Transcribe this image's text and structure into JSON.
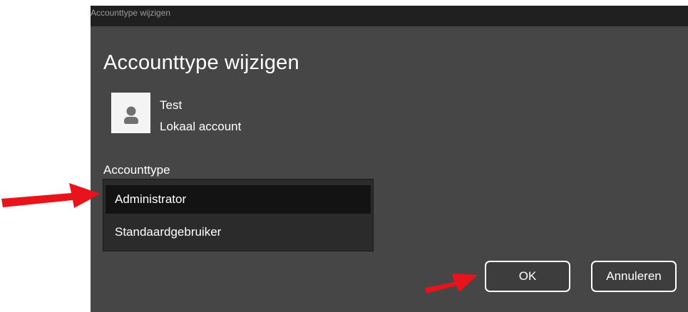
{
  "window": {
    "title": "Accounttype wijzigen"
  },
  "dialog": {
    "heading": "Accounttype wijzigen",
    "user": {
      "name": "Test",
      "type": "Lokaal account",
      "avatar_icon": "user-icon"
    },
    "field_label": "Accounttype",
    "account_type_options": [
      {
        "label": "Administrator",
        "selected": true
      },
      {
        "label": "Standaardgebruiker",
        "selected": false
      }
    ],
    "buttons": {
      "ok_label": "OK",
      "cancel_label": "Annuleren"
    }
  },
  "annotations": {
    "arrow_color": "#e8141b",
    "arrow_icon": "red-arrow-icon"
  },
  "colors": {
    "dialog_background": "#464646",
    "titlebar_background": "#202020",
    "dropdown_background": "#2b2b2b",
    "selected_option_background": "#131313"
  }
}
